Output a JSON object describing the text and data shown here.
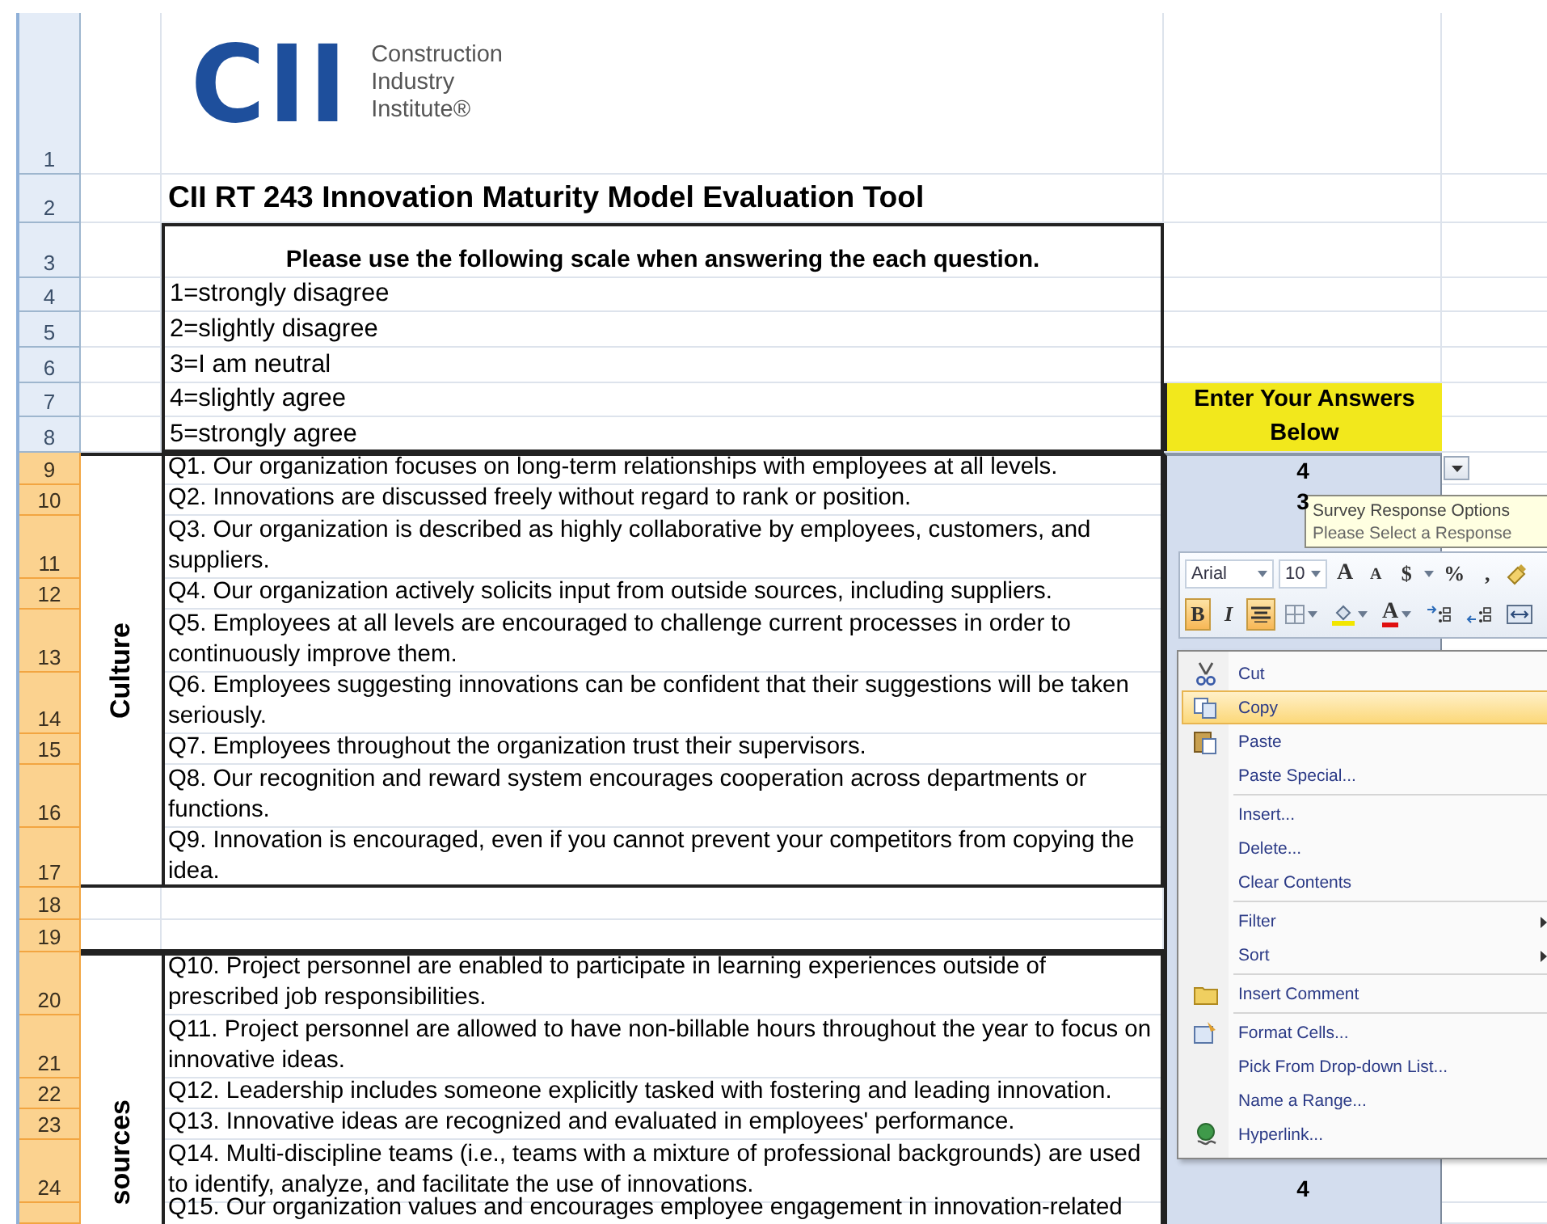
{
  "logo": {
    "mark": "CII",
    "name_lines": [
      "Construction",
      "Industry",
      "Institute®"
    ]
  },
  "title": "CII RT 243 Innovation Maturity Model Evaluation Tool",
  "scale": {
    "heading": "Please use the following scale when answering the each question.",
    "items": [
      "1=strongly disagree",
      "2=slightly disagree",
      "3=I am neutral",
      "4=slightly agree",
      "5=strongly agree"
    ]
  },
  "answer_header": "Enter Your Answers Below",
  "row_headers": [
    {
      "label": "1",
      "selected": false
    },
    {
      "label": "2",
      "selected": false
    },
    {
      "label": "3",
      "selected": false
    },
    {
      "label": "4",
      "selected": false
    },
    {
      "label": "5",
      "selected": false
    },
    {
      "label": "6",
      "selected": false
    },
    {
      "label": "7",
      "selected": false
    },
    {
      "label": "8",
      "selected": false
    },
    {
      "label": "9",
      "selected": true
    },
    {
      "label": "10",
      "selected": true
    },
    {
      "label": "11",
      "selected": true
    },
    {
      "label": "12",
      "selected": true
    },
    {
      "label": "13",
      "selected": true
    },
    {
      "label": "14",
      "selected": true
    },
    {
      "label": "15",
      "selected": true
    },
    {
      "label": "16",
      "selected": true
    },
    {
      "label": "17",
      "selected": true
    },
    {
      "label": "18",
      "selected": true
    },
    {
      "label": "19",
      "selected": true
    },
    {
      "label": "20",
      "selected": true
    },
    {
      "label": "21",
      "selected": true
    },
    {
      "label": "22",
      "selected": true
    },
    {
      "label": "23",
      "selected": true
    },
    {
      "label": "24",
      "selected": true
    },
    {
      "selected": true
    }
  ],
  "sections": [
    {
      "label": "Culture",
      "questions": [
        {
          "text": "Q1. Our organization focuses on long-term relationships with employees at all levels.",
          "answer": "4"
        },
        {
          "text": "Q2. Innovations are discussed freely without regard to rank or position.",
          "answer": "3"
        },
        {
          "text": "Q3. Our organization is described as highly collaborative by employees, customers, and suppliers."
        },
        {
          "text": "Q4. Our organization actively solicits input from outside sources, including suppliers."
        },
        {
          "text": "Q5. Employees at all levels are encouraged to challenge current processes in order to continuously improve them."
        },
        {
          "text": "Q6. Employees suggesting innovations can be confident that their suggestions will be taken seriously."
        },
        {
          "text": "Q7. Employees throughout the organization trust their supervisors."
        },
        {
          "text": "Q8. Our recognition and reward system encourages cooperation across departments or functions."
        },
        {
          "text": "Q9. Innovation is encouraged, even if you cannot prevent your competitors from copying the idea."
        }
      ]
    },
    {
      "label": "sources",
      "questions": [
        {
          "text": "Q10. Project personnel are enabled to participate in learning experiences outside of prescribed job responsibilities."
        },
        {
          "text": "Q11. Project personnel are allowed to have non-billable hours throughout the year to focus on innovative ideas."
        },
        {
          "text": "Q12. Leadership includes someone explicitly tasked with fostering and leading innovation."
        },
        {
          "text": "Q13. Innovative ideas are recognized and evaluated in employees' performance."
        },
        {
          "text": "Q14. Multi-discipline teams (i.e., teams with a mixture of professional backgrounds) are used to identify, analyze, and facilitate the use of innovations.",
          "answer": "4"
        },
        {
          "text": "Q15. Our organization values and encourages employee engagement in innovation-related"
        }
      ]
    }
  ],
  "tooltip": {
    "title": "Survey Response Options",
    "message": "Please Select a Response"
  },
  "mini_toolbar": {
    "row1": [
      {
        "kind": "font",
        "label": "Arial"
      },
      {
        "kind": "size",
        "label": "10"
      },
      {
        "kind": "grow",
        "label": "A"
      },
      {
        "kind": "shrink",
        "label": "A"
      },
      {
        "kind": "currency",
        "label": "$"
      },
      {
        "kind": "percent",
        "label": "%"
      },
      {
        "kind": "comma",
        "label": ","
      },
      {
        "kind": "brush"
      }
    ],
    "row2": [
      {
        "kind": "bold",
        "label": "B",
        "selected": true
      },
      {
        "kind": "italic",
        "label": "I",
        "selected": false
      },
      {
        "kind": "center",
        "selected": true
      },
      {
        "kind": "borders",
        "selected": false
      },
      {
        "kind": "fill",
        "selected": false
      },
      {
        "kind": "font-color",
        "label": "A",
        "selected": false
      },
      {
        "kind": "increase-decimal",
        "selected": false
      },
      {
        "kind": "decrease-decimal",
        "selected": false
      },
      {
        "kind": "merge",
        "selected": false
      }
    ]
  },
  "context_menu": [
    {
      "label": "Cut",
      "selected": false
    },
    {
      "label": "Copy",
      "selected": true
    },
    {
      "label": "Paste",
      "selected": false
    },
    {
      "label": "Paste Special...",
      "selected": false
    },
    {
      "label": "Insert...",
      "selected": false,
      "separator_before": true
    },
    {
      "label": "Delete...",
      "selected": false
    },
    {
      "label": "Clear Contents",
      "selected": false
    },
    {
      "label": "Filter",
      "selected": false,
      "separator_before": true,
      "submenu": true
    },
    {
      "label": "Sort",
      "selected": false,
      "submenu": true
    },
    {
      "label": "Insert Comment",
      "selected": false,
      "separator_before": true
    },
    {
      "label": "Format Cells...",
      "selected": false,
      "separator_before": true
    },
    {
      "label": "Pick From Drop-down List...",
      "selected": false
    },
    {
      "label": "Name a Range...",
      "selected": false
    },
    {
      "label": "Hyperlink...",
      "selected": false
    }
  ]
}
